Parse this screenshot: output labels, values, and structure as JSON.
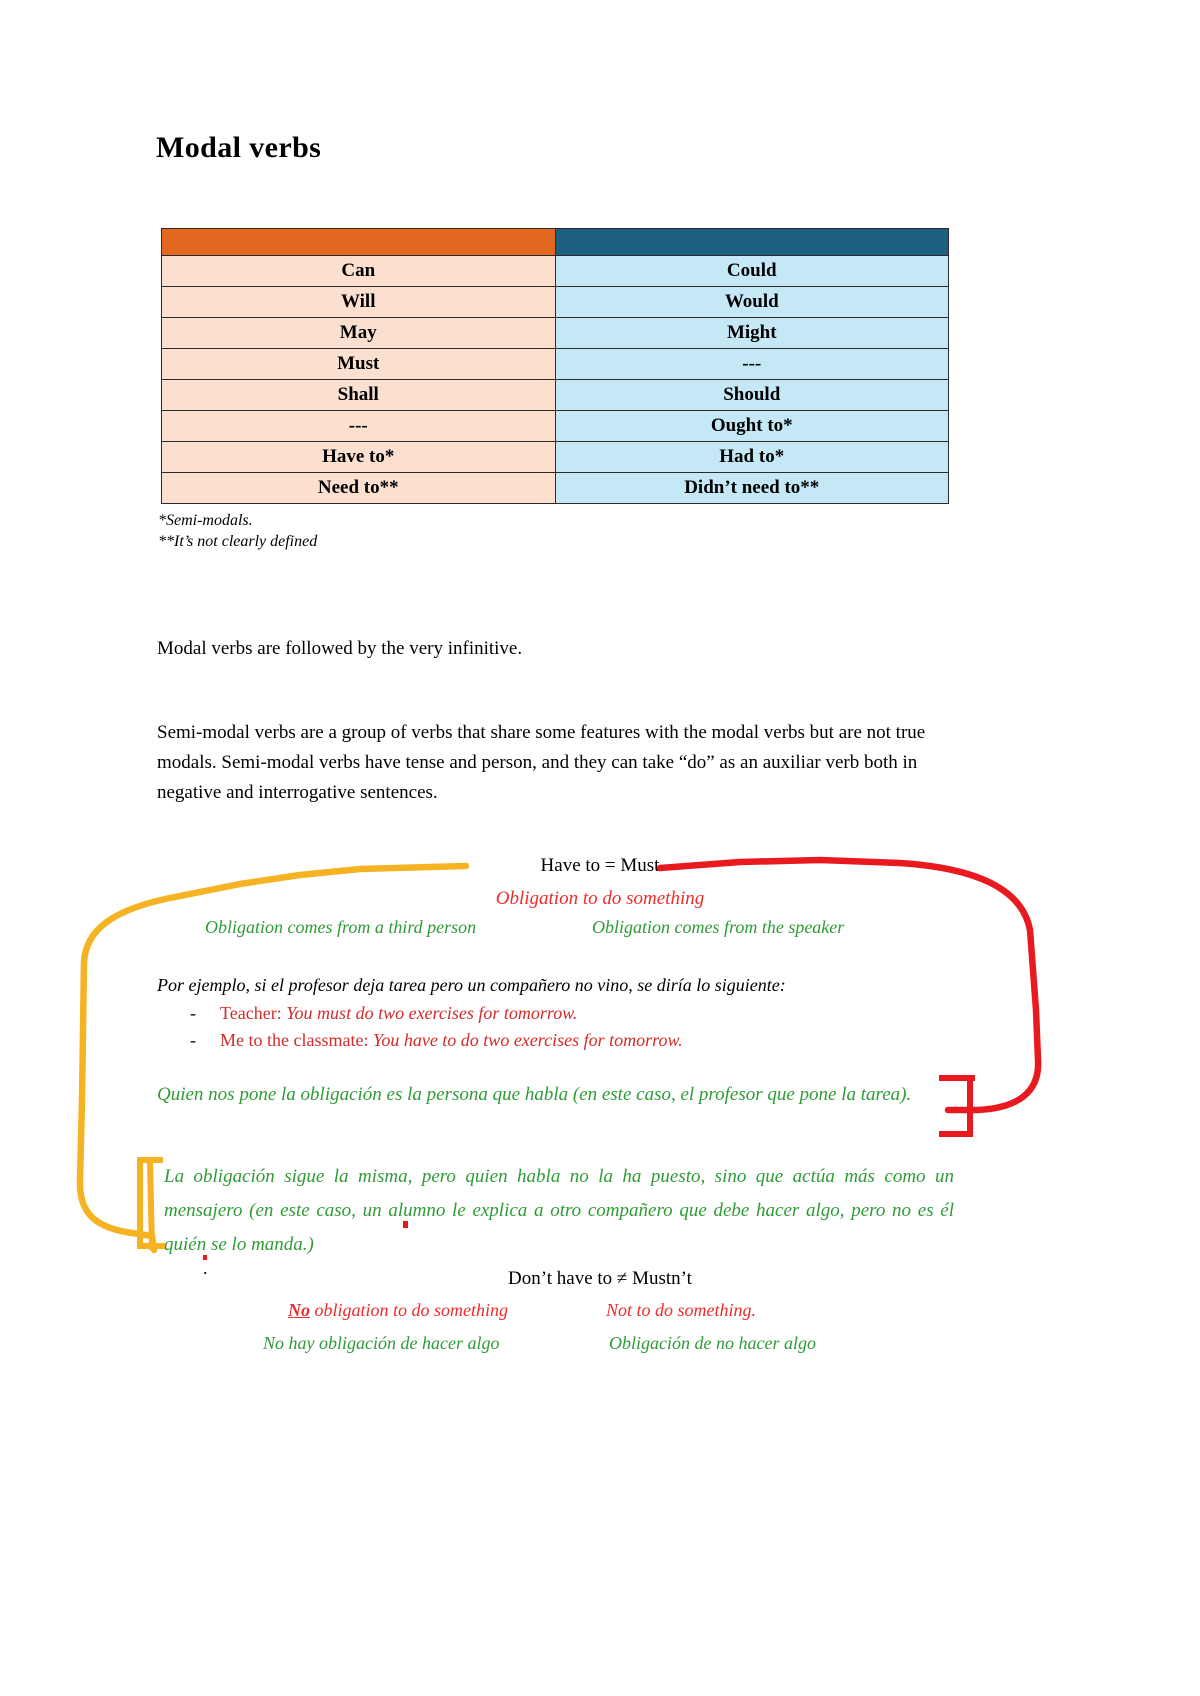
{
  "document": {
    "title": "Modal verbs"
  },
  "table": {
    "header": {
      "left": "",
      "right": ""
    },
    "rows": [
      {
        "left": "Can",
        "right": "Could"
      },
      {
        "left": "Will",
        "right": "Would"
      },
      {
        "left": "May",
        "right": "Might"
      },
      {
        "left": "Must",
        "right": "---"
      },
      {
        "left": "Shall",
        "right": "Should"
      },
      {
        "left": "---",
        "right": "Ought to*"
      },
      {
        "left": "Have to*",
        "right": "Had to*"
      },
      {
        "left": "Need to**",
        "right": "Didn’t need to**"
      }
    ],
    "colors": {
      "header_left": "#e2671f",
      "header_right": "#1f6080",
      "cell_left": "#fbe0d0",
      "cell_right": "#c5e8f7",
      "border": "#2b2b2b"
    }
  },
  "footnotes": {
    "one": "*Semi-modals.",
    "two": "**It’s not clearly defined"
  },
  "paragraphs": {
    "p1": "Modal verbs are followed by the very infinitive.",
    "p2": "Semi-modal verbs are a group of verbs that share some features with the modal verbs but are not true modals. Semi-modal verbs have tense and person, and they can take “do” as an auxiliar verb both in negative and interrogative sentences."
  },
  "annotations": {
    "equation": "Have to = Must",
    "red_center": "Obligation to do something",
    "green_left": "Obligation comes from a third person",
    "green_right": "Obligation comes from the speaker",
    "example_intro": "Por ejemplo, si el profesor deja tarea pero un compañero no vino, se diría lo siguiente:",
    "bullets": [
      {
        "dash": "-",
        "label": "Teacher:",
        "text": "You must do two exercises for tomorrow."
      },
      {
        "dash": "-",
        "label": "Me to the classmate:",
        "text": "You have to do two exercises for tomorrow."
      }
    ],
    "green_block_1": "Quien nos pone la obligación es la persona que habla (en este caso, el profesor que pone la tarea).",
    "green_block_2": "La obligación sigue la misma, pero quien habla no la ha puesto, sino que actúa más como un mensajero (en este caso, un alumno le explica a otro compañero que debe hacer algo, pero no es él quién se lo manda.)",
    "dot": ".",
    "bottom_title": "Don’t have to ≠ Mustn’t",
    "bottom_red_left_underlined": "No",
    "bottom_red_left_rest": " obligation to do something",
    "bottom_red_right": "Not to do something.",
    "bottom_green_left": "No hay obligación de hacer algo",
    "bottom_green_right": "Obligación de no hacer algo",
    "ink_colors": {
      "yellow": "#f5b324",
      "red": "#e8191f",
      "green": "#2f9b36"
    }
  }
}
